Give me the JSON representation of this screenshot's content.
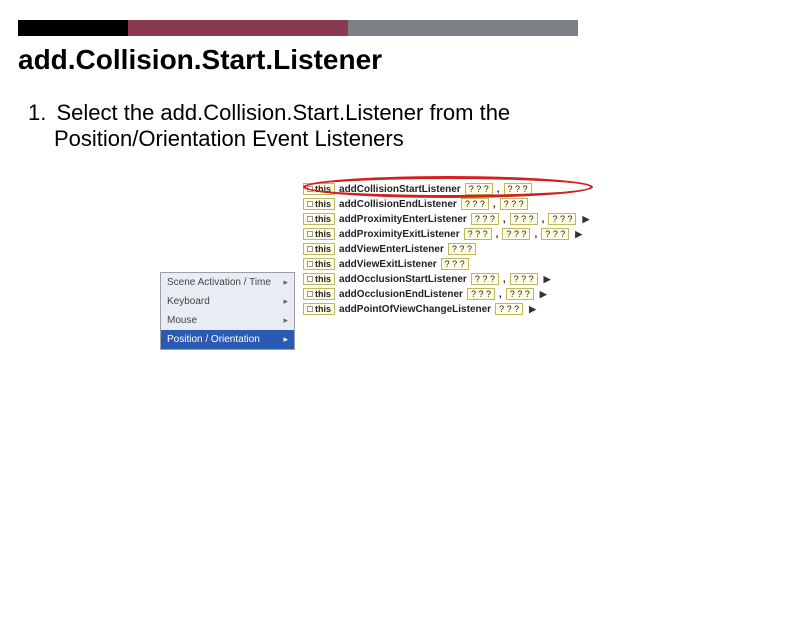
{
  "title": "add.Collision.Start.Listener",
  "instruction": {
    "number": "1.",
    "line1": "Select the add.Collision.Start.Listener from the",
    "line2": "Position/Orientation Event Listeners"
  },
  "leftMenu": {
    "items": [
      {
        "label": "Scene Activation / Time"
      },
      {
        "label": "Keyboard"
      },
      {
        "label": "Mouse"
      },
      {
        "label": "Position / Orientation",
        "selected": true
      }
    ]
  },
  "listeners": [
    {
      "this": "this",
      "name": "addCollisionStartListener",
      "params": [
        "? ? ?",
        "? ? ?"
      ],
      "hasCaret": false
    },
    {
      "this": "this",
      "name": "addCollisionEndListener",
      "params": [
        "? ? ?",
        "? ? ?"
      ],
      "hasCaret": false
    },
    {
      "this": "this",
      "name": "addProximityEnterListener",
      "params": [
        "? ? ?",
        "? ? ?",
        "? ? ?"
      ],
      "hasCaret": true
    },
    {
      "this": "this",
      "name": "addProximityExitListener",
      "params": [
        "? ? ?",
        "? ? ?",
        "? ? ?"
      ],
      "hasCaret": true
    },
    {
      "this": "this",
      "name": "addViewEnterListener",
      "params": [
        "? ? ?"
      ],
      "hasCaret": false
    },
    {
      "this": "this",
      "name": "addViewExitListener",
      "params": [
        "? ? ?"
      ],
      "hasCaret": false
    },
    {
      "this": "this",
      "name": "addOcclusionStartListener",
      "params": [
        "? ? ?",
        "? ? ?"
      ],
      "hasCaret": true
    },
    {
      "this": "this",
      "name": "addOcclusionEndListener",
      "params": [
        "? ? ?",
        "? ? ?"
      ],
      "hasCaret": true
    },
    {
      "this": "this",
      "name": "addPointOfViewChangeListener",
      "params": [
        "? ? ?"
      ],
      "hasCaret": true
    }
  ],
  "paramSep": ",",
  "glyphs": {
    "caret": "▶",
    "arrow": "▸"
  }
}
